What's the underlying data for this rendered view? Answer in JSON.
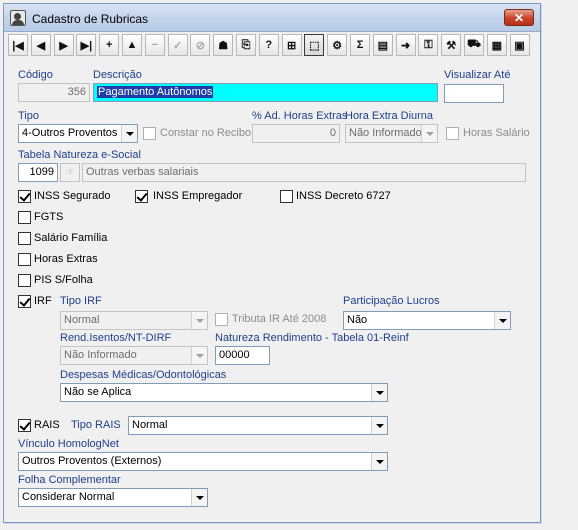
{
  "window": {
    "title": "Cadastro de Rubricas",
    "close_label": "✕"
  },
  "toolbar": {
    "buttons": [
      {
        "name": "first-record-button",
        "glyph": "|◀"
      },
      {
        "name": "prev-record-button",
        "glyph": "◀"
      },
      {
        "name": "next-record-button",
        "glyph": "▶"
      },
      {
        "name": "last-record-button",
        "glyph": "▶|"
      },
      {
        "name": "insert-button",
        "glyph": "+"
      },
      {
        "name": "edit-button",
        "glyph": "▲"
      },
      {
        "name": "delete-button",
        "glyph": "−"
      },
      {
        "name": "post-button",
        "glyph": "✓"
      },
      {
        "name": "cancel-button",
        "glyph": "⊘"
      },
      {
        "name": "print-button",
        "glyph": "☗"
      },
      {
        "name": "copy-button",
        "glyph": "⎘"
      },
      {
        "name": "help-button",
        "glyph": "?"
      },
      {
        "name": "filter-button",
        "glyph": "⊞"
      },
      {
        "name": "select-button",
        "glyph": "⬚"
      },
      {
        "name": "export-button",
        "glyph": "⚙"
      },
      {
        "name": "sum-button",
        "glyph": "Σ"
      },
      {
        "name": "report-button",
        "glyph": "▤"
      },
      {
        "name": "exit-button",
        "glyph": "➜"
      },
      {
        "name": "key-button",
        "glyph": "⚿"
      },
      {
        "name": "tools-button",
        "glyph": "⚒"
      },
      {
        "name": "transport-button",
        "glyph": "⛟"
      },
      {
        "name": "grid-button",
        "glyph": "▦"
      },
      {
        "name": "window-button",
        "glyph": "▣"
      }
    ]
  },
  "form": {
    "codigo": {
      "label": "Código",
      "value": "356"
    },
    "descricao": {
      "label": "Descrição",
      "value": "Pagamento Autônomos"
    },
    "visualizar_ate": {
      "label": "Visualizar Até",
      "value": ""
    },
    "tipo": {
      "label": "Tipo",
      "value": "4-Outros Proventos"
    },
    "constar_recibo": {
      "label": "Constar no Recibo"
    },
    "ad_horas_extras": {
      "label": "% Ad. Horas Extras",
      "value": "0"
    },
    "hora_extra_diurna": {
      "label": "Hora Extra Diurna",
      "value": "Não Informado"
    },
    "horas_salario": {
      "label": "Horas Salário"
    },
    "natureza_esocial": {
      "label": "Tabela Natureza e-Social",
      "code": "1099",
      "description": "Outras verbas salariais"
    },
    "inss_segurado": {
      "label": "INSS Segurado",
      "checked": true
    },
    "inss_empregador": {
      "label": "INSS Empregador",
      "checked": true
    },
    "inss_decreto": {
      "label": "INSS Decreto 6727",
      "checked": false
    },
    "fgts": {
      "label": "FGTS",
      "checked": false
    },
    "salario_familia": {
      "label": "Salário Família",
      "checked": false
    },
    "horas_extras": {
      "label": "Horas Extras",
      "checked": false
    },
    "pis_folha": {
      "label": "PIS S/Folha",
      "checked": false
    },
    "irf": {
      "label": "IRF",
      "checked": true
    },
    "tipo_irf": {
      "label": "Tipo IRF",
      "value": "Normal"
    },
    "tributa_ir_2008": {
      "label": "Tributa IR Até 2008"
    },
    "participacao_lucros": {
      "label": "Participação Lucros",
      "value": "Não"
    },
    "rend_isentos": {
      "label": "Rend.Isentos/NT-DIRF",
      "value": "Não Informado"
    },
    "natureza_rendimento": {
      "label": "Natureza Rendimento - Tabela 01-Reinf",
      "value": "00000"
    },
    "despesas_medicas": {
      "label": "Despesas Médicas/Odontológicas",
      "value": "Não se Aplica"
    },
    "rais": {
      "label": "RAIS",
      "checked": true
    },
    "tipo_rais": {
      "label": "Tipo RAIS",
      "value": "Normal"
    },
    "vinculo_homolognet": {
      "label": "Vínculo HomologNet",
      "value": "Outros Proventos (Externos)"
    },
    "folha_complementar": {
      "label": "Folha Complementar",
      "value": "Considerar Normal"
    }
  }
}
